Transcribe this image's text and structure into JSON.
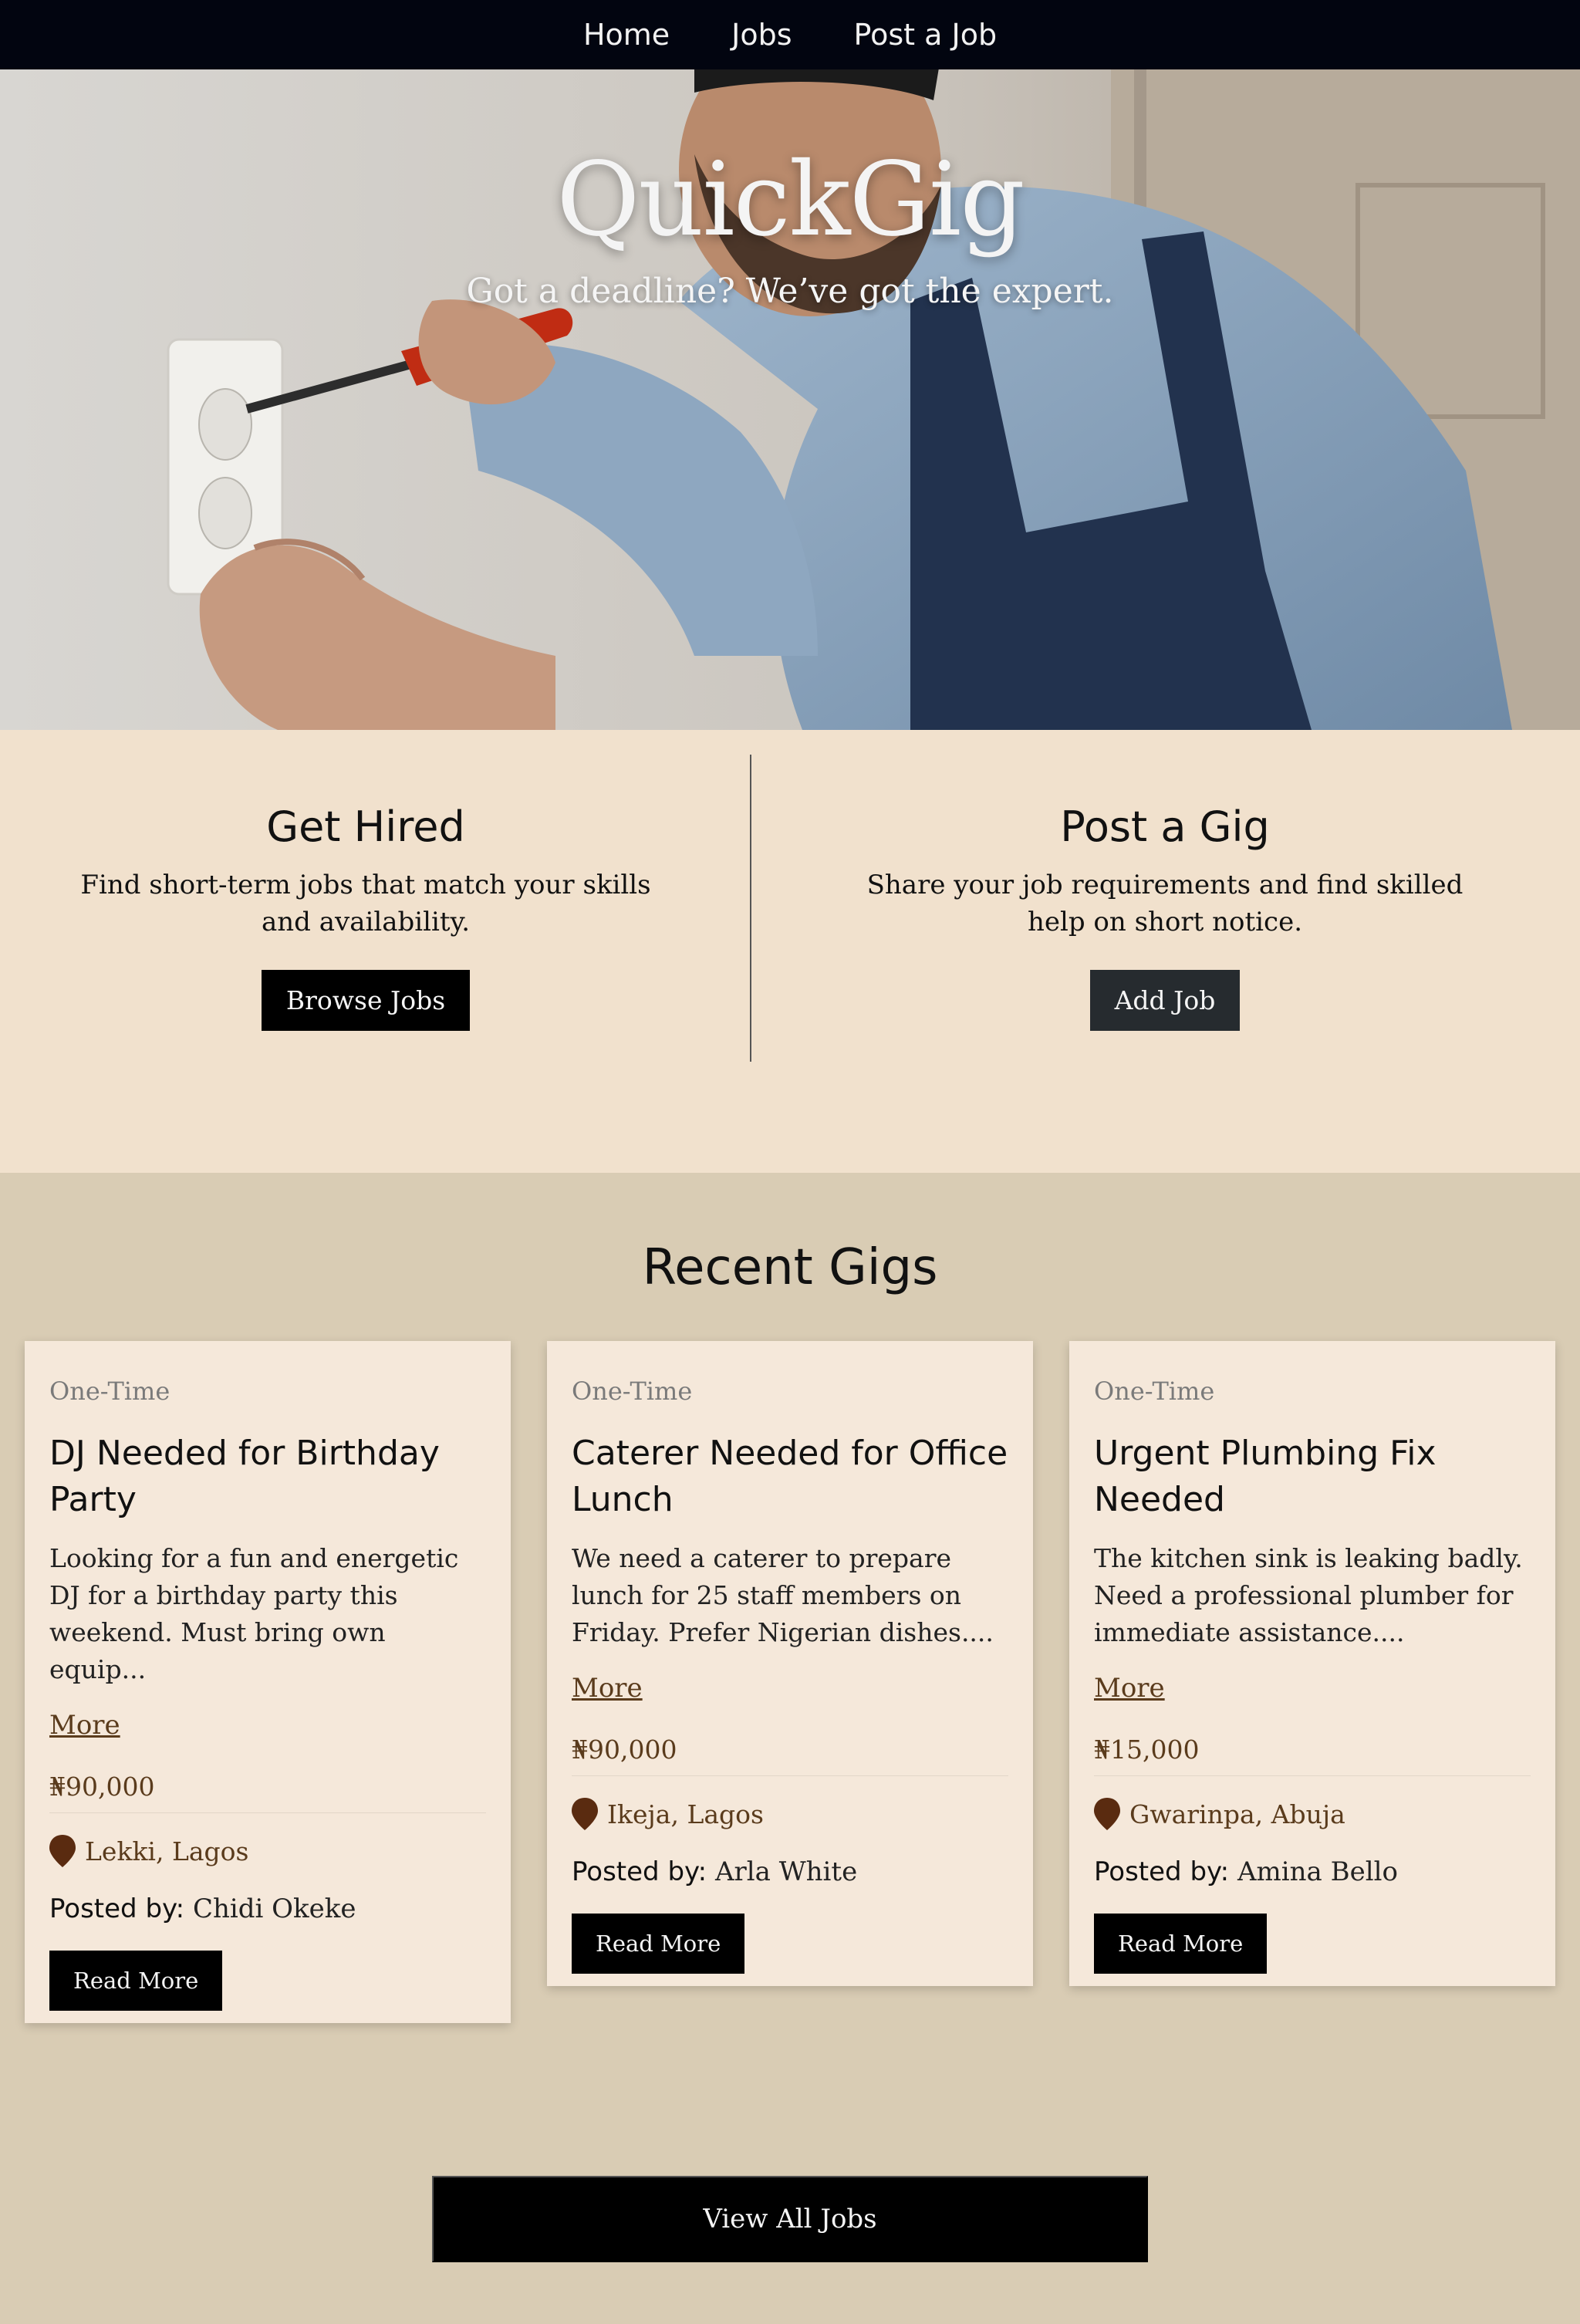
{
  "nav": {
    "links": [
      "Home",
      "Jobs",
      "Post a Job"
    ]
  },
  "hero": {
    "title": "QuickGig",
    "subtitle": "Got a deadline? We’ve got the expert."
  },
  "cta": {
    "hired": {
      "title": "Get Hired",
      "text": "Find short-term jobs that match your skills and availability.",
      "button": "Browse Jobs"
    },
    "gig": {
      "title": "Post a Gig",
      "text": "Share your job requirements and find skilled help on short notice.",
      "button": "Add Job"
    }
  },
  "recent": {
    "title": "Recent Gigs",
    "posted_label": "Posted by:",
    "more_label": "More",
    "read_more_label": "Read More",
    "view_all_label": "View All Jobs",
    "cards": [
      {
        "type": "One-Time",
        "title": "DJ Needed for Birthday Party",
        "desc": "Looking for a fun and energetic DJ for a birthday party this weekend. Must bring own equip...",
        "price": "₦90,000",
        "location": "Lekki, Lagos",
        "poster": "Chidi Okeke"
      },
      {
        "type": "One-Time",
        "title": "Caterer Needed for Office Lunch",
        "desc": "We need a caterer to prepare lunch for 25 staff members on Friday. Prefer Nigerian dishes....",
        "price": "₦90,000",
        "location": "Ikeja, Lagos",
        "poster": "Arla White"
      },
      {
        "type": "One-Time",
        "title": "Urgent Plumbing Fix Needed",
        "desc": "The kitchen sink is leaking badly. Need a professional plumber for immediate assistance....",
        "price": "₦15,000",
        "location": "Gwarinpa, Abuja",
        "poster": "Amina Bello"
      }
    ]
  },
  "colors": {
    "nav_bg": "#020510",
    "cta_bg": "#f1e1cd",
    "recent_bg": "#d9ccb4",
    "card_bg": "#f5e8da",
    "accent_brown": "#5a3b1c"
  },
  "icons": {
    "location": "map-pin-icon"
  }
}
